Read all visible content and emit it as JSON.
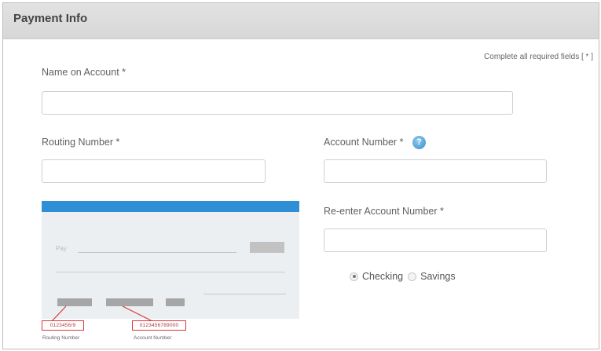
{
  "header": {
    "title": "Payment Info"
  },
  "required_note": "Complete all required fields [ * ]",
  "fields": {
    "name_on_account": {
      "label": "Name on Account *",
      "value": ""
    },
    "routing_number": {
      "label": "Routing Number *",
      "value": ""
    },
    "account_number": {
      "label": "Account Number *",
      "value": ""
    },
    "reenter_account_number": {
      "label": "Re-enter Account Number *",
      "value": ""
    }
  },
  "help_icon": {
    "glyph": "?"
  },
  "check_illustration": {
    "pay_label": "Pay",
    "routing_example": "0123456/9",
    "routing_caption": "Routing Number",
    "account_example": "0123456789000",
    "account_caption": "Account Number",
    "accent_color": "#2e8fd6",
    "highlight_color": "#d9373e"
  },
  "account_type": {
    "options": [
      {
        "label": "Checking",
        "checked": true
      },
      {
        "label": "Savings",
        "checked": false
      }
    ]
  }
}
